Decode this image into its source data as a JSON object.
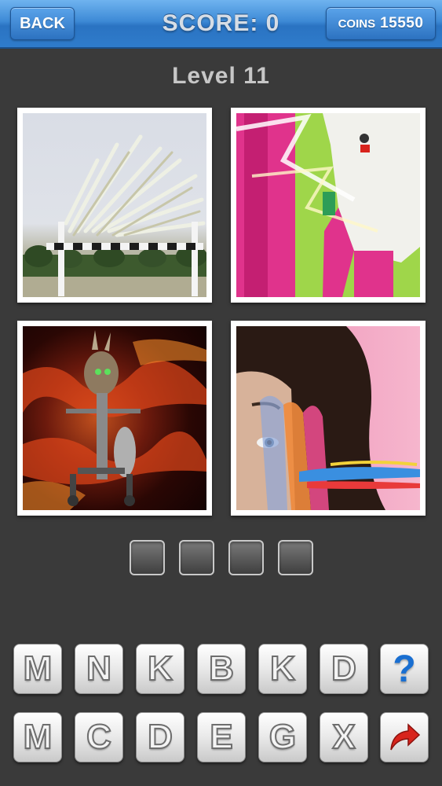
{
  "topbar": {
    "back_label": "BACK",
    "score_label": "SCORE: 0",
    "coins_label": "COINS",
    "coins_value": "15550"
  },
  "level_title": "Level 11",
  "pictures": [
    {
      "name": "picture-hurdle-broom"
    },
    {
      "name": "picture-pink-legs-microphone"
    },
    {
      "name": "picture-creature-fire"
    },
    {
      "name": "picture-face-pink-paint"
    }
  ],
  "answer_slots": [
    "",
    "",
    "",
    ""
  ],
  "letters_row1": [
    "M",
    "N",
    "K",
    "B",
    "K",
    "D"
  ],
  "letters_row2": [
    "M",
    "C",
    "D",
    "E",
    "G",
    "X"
  ],
  "hint_icon": "question-mark-icon",
  "skip_icon": "red-forward-arrow-icon",
  "colors": {
    "topbar": "#3d8ad6",
    "background": "#3a3a3a",
    "hint": "#1a6fd1",
    "skip_arrow": "#d8241c"
  }
}
